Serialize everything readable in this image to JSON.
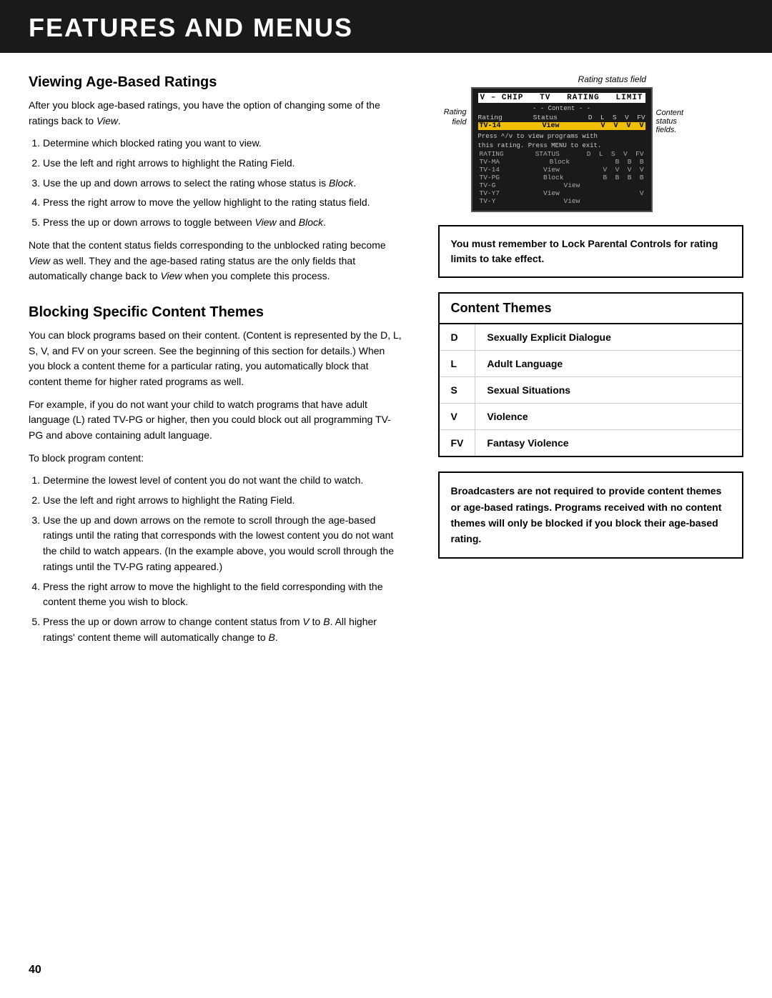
{
  "header": {
    "title": "Features and Menus"
  },
  "page_number": "40",
  "left": {
    "section1": {
      "title": "Viewing Age-Based Ratings",
      "intro": "After you block age-based ratings, you have the option of changing some of the ratings back to View.",
      "steps": [
        "Determine which blocked rating you want to view.",
        "Use the left and right arrows to highlight the Rating Field.",
        "Use the up and down arrows to select the rating whose status is Block.",
        "Press the right arrow to move the yellow highlight to the rating status field.",
        "Press the up or down arrows to toggle between View and Block."
      ],
      "note1": "Note that the content status fields corresponding to the unblocked rating become View as well. They and the age-based rating status are the only fields that automatically change back to View when you complete this process."
    },
    "section2": {
      "title": "Blocking Specific Content Themes",
      "para1": "You can block programs based on their content. (Content is represented by the D, L, S, V, and FV on your screen. See the beginning of this section for details.) When you block a content theme for a particular rating, you automatically block that content theme for higher rated programs as well.",
      "para2": "For example, if you do not want your child to watch programs that have adult language (L) rated TV-PG or higher, then you could block out all programming TV-PG and above containing adult language.",
      "para3": "To block program content:",
      "steps": [
        "Determine the lowest level of content you do not want the child to watch.",
        "Use the left and right arrows to highlight the Rating Field.",
        "Use the up and down arrows on the remote to scroll through the age-based ratings until the rating that corresponds with the lowest content you do not want the child to watch appears. (In the example above, you would scroll through the ratings until the TV-PG rating appeared.)",
        "Press the right arrow to move the highlight to the field corresponding with the content theme you wish to block.",
        "Press the up or down arrow to change content status from V to B. All higher ratings' content theme will automatically change to B."
      ]
    }
  },
  "right": {
    "rating_status_label": "Rating status field",
    "rating_field_label": "Rating\nfield",
    "content_status_label": "Content\nstatus\nfields.",
    "chip_title": "V – C H I P   T V   R A T I N G   L I M I T",
    "chip_subtitle": "- - Content - -",
    "chip_cols": "Rating    Status    D  L  S  V  FV",
    "highlight_row": {
      "rating": "TV-14",
      "status": "View",
      "content": "V  V  V  V"
    },
    "chip_note": "Press ^/v to view programs with this rating. Press MENU to exit.",
    "data_rows": [
      {
        "rating": "RATING",
        "status": "STATUS",
        "content": "D  L  S  V  FV"
      },
      {
        "rating": "TV-MA",
        "status": "Block",
        "content": "B  B  B"
      },
      {
        "rating": "TV-14",
        "status": "View",
        "content": "V  V  V  V"
      },
      {
        "rating": "TV-PG",
        "status": "Block",
        "content": "B  B  B  B"
      },
      {
        "rating": "TV-G",
        "status": "View",
        "content": ""
      },
      {
        "rating": "TV-Y7",
        "status": "View",
        "content": "V"
      },
      {
        "rating": "TV-Y",
        "status": "View",
        "content": ""
      }
    ],
    "warning_box": "You must remember to Lock Parental Controls for rating limits to take effect.",
    "content_themes": {
      "title": "Content Themes",
      "rows": [
        {
          "code": "D",
          "label": "Sexually Explicit Dialogue"
        },
        {
          "code": "L",
          "label": "Adult Language"
        },
        {
          "code": "S",
          "label": "Sexual Situations"
        },
        {
          "code": "V",
          "label": "Violence"
        },
        {
          "code": "FV",
          "label": "Fantasy Violence"
        }
      ]
    },
    "bottom_note": "Broadcasters are not required to provide content themes or age-based ratings. Programs received with no content themes will only be blocked if you block their age-based rating."
  }
}
